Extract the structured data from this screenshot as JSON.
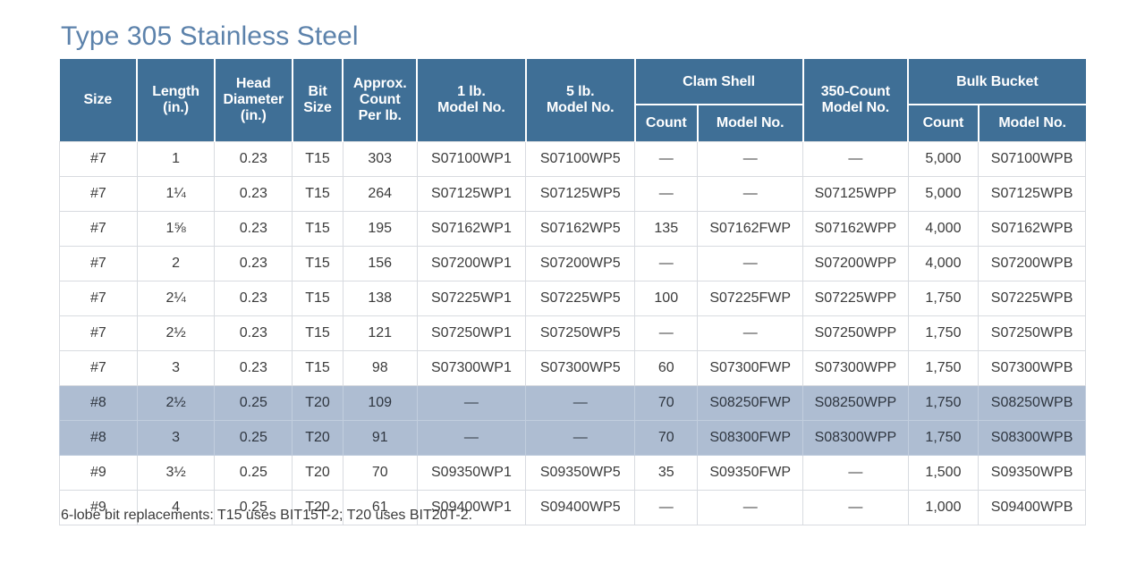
{
  "title": "Type 305 Stainless Steel",
  "colors": {
    "title": "#5c82ab",
    "header_bg": "#3f6f96",
    "header_text": "#ffffff",
    "highlight_row": "#aebdd2",
    "grid": "#d8dbe0",
    "body_text": "#3b3b3b"
  },
  "footnote": "6-lobe bit replacements: T15 uses BIT15T-2; T20 uses BIT20T-2.",
  "header": {
    "size": "Size",
    "length": "Length\n(in.)",
    "length_l1": "Length",
    "length_l2": "(in.)",
    "head_diameter_l1": "Head",
    "head_diameter_l2": "Diameter",
    "head_diameter_l3": "(in.)",
    "bit_size_l1": "Bit",
    "bit_size_l2": "Size",
    "approx_count_l1": "Approx.",
    "approx_count_l2": "Count",
    "approx_count_l3": "Per lb.",
    "one_lb_l1": "1 lb.",
    "one_lb_l2": "Model No.",
    "five_lb_l1": "5 lb.",
    "five_lb_l2": "Model No.",
    "clam_shell": "Clam Shell",
    "clam_shell_count": "Count",
    "clam_shell_model": "Model No.",
    "count350_l1": "350-Count",
    "count350_l2": "Model No.",
    "bulk_bucket": "Bulk Bucket",
    "bulk_count": "Count",
    "bulk_model": "Model No."
  },
  "rows": [
    {
      "highlight": false,
      "size": "#7",
      "length": "1",
      "head_diameter": "0.23",
      "bit_size": "T15",
      "approx_count": "303",
      "model_1lb": "S07100WP1",
      "model_5lb": "S07100WP5",
      "clam_count": "—",
      "clam_model": "—",
      "model_350": "—",
      "bulk_count": "5,000",
      "bulk_model": "S07100WPB"
    },
    {
      "highlight": false,
      "size": "#7",
      "length": "1¼",
      "head_diameter": "0.23",
      "bit_size": "T15",
      "approx_count": "264",
      "model_1lb": "S07125WP1",
      "model_5lb": "S07125WP5",
      "clam_count": "—",
      "clam_model": "—",
      "model_350": "S07125WPP",
      "bulk_count": "5,000",
      "bulk_model": "S07125WPB"
    },
    {
      "highlight": false,
      "size": "#7",
      "length": "1⅝",
      "head_diameter": "0.23",
      "bit_size": "T15",
      "approx_count": "195",
      "model_1lb": "S07162WP1",
      "model_5lb": "S07162WP5",
      "clam_count": "135",
      "clam_model": "S07162FWP",
      "model_350": "S07162WPP",
      "bulk_count": "4,000",
      "bulk_model": "S07162WPB"
    },
    {
      "highlight": false,
      "size": "#7",
      "length": "2",
      "head_diameter": "0.23",
      "bit_size": "T15",
      "approx_count": "156",
      "model_1lb": "S07200WP1",
      "model_5lb": "S07200WP5",
      "clam_count": "—",
      "clam_model": "—",
      "model_350": "S07200WPP",
      "bulk_count": "4,000",
      "bulk_model": "S07200WPB"
    },
    {
      "highlight": false,
      "size": "#7",
      "length": "2¼",
      "head_diameter": "0.23",
      "bit_size": "T15",
      "approx_count": "138",
      "model_1lb": "S07225WP1",
      "model_5lb": "S07225WP5",
      "clam_count": "100",
      "clam_model": "S07225FWP",
      "model_350": "S07225WPP",
      "bulk_count": "1,750",
      "bulk_model": "S07225WPB"
    },
    {
      "highlight": false,
      "size": "#7",
      "length": "2½",
      "head_diameter": "0.23",
      "bit_size": "T15",
      "approx_count": "121",
      "model_1lb": "S07250WP1",
      "model_5lb": "S07250WP5",
      "clam_count": "—",
      "clam_model": "—",
      "model_350": "S07250WPP",
      "bulk_count": "1,750",
      "bulk_model": "S07250WPB"
    },
    {
      "highlight": false,
      "size": "#7",
      "length": "3",
      "head_diameter": "0.23",
      "bit_size": "T15",
      "approx_count": "98",
      "model_1lb": "S07300WP1",
      "model_5lb": "S07300WP5",
      "clam_count": "60",
      "clam_model": "S07300FWP",
      "model_350": "S07300WPP",
      "bulk_count": "1,750",
      "bulk_model": "S07300WPB"
    },
    {
      "highlight": true,
      "size": "#8",
      "length": "2½",
      "head_diameter": "0.25",
      "bit_size": "T20",
      "approx_count": "109",
      "model_1lb": "—",
      "model_5lb": "—",
      "clam_count": "70",
      "clam_model": "S08250FWP",
      "model_350": "S08250WPP",
      "bulk_count": "1,750",
      "bulk_model": "S08250WPB"
    },
    {
      "highlight": true,
      "size": "#8",
      "length": "3",
      "head_diameter": "0.25",
      "bit_size": "T20",
      "approx_count": "91",
      "model_1lb": "—",
      "model_5lb": "—",
      "clam_count": "70",
      "clam_model": "S08300FWP",
      "model_350": "S08300WPP",
      "bulk_count": "1,750",
      "bulk_model": "S08300WPB"
    },
    {
      "highlight": false,
      "size": "#9",
      "length": "3½",
      "head_diameter": "0.25",
      "bit_size": "T20",
      "approx_count": "70",
      "model_1lb": "S09350WP1",
      "model_5lb": "S09350WP5",
      "clam_count": "35",
      "clam_model": "S09350FWP",
      "model_350": "—",
      "bulk_count": "1,500",
      "bulk_model": "S09350WPB"
    },
    {
      "highlight": false,
      "size": "#9",
      "length": "4",
      "head_diameter": "0.25",
      "bit_size": "T20",
      "approx_count": "61",
      "model_1lb": "S09400WP1",
      "model_5lb": "S09400WP5",
      "clam_count": "—",
      "clam_model": "—",
      "model_350": "—",
      "bulk_count": "1,000",
      "bulk_model": "S09400WPB"
    }
  ]
}
